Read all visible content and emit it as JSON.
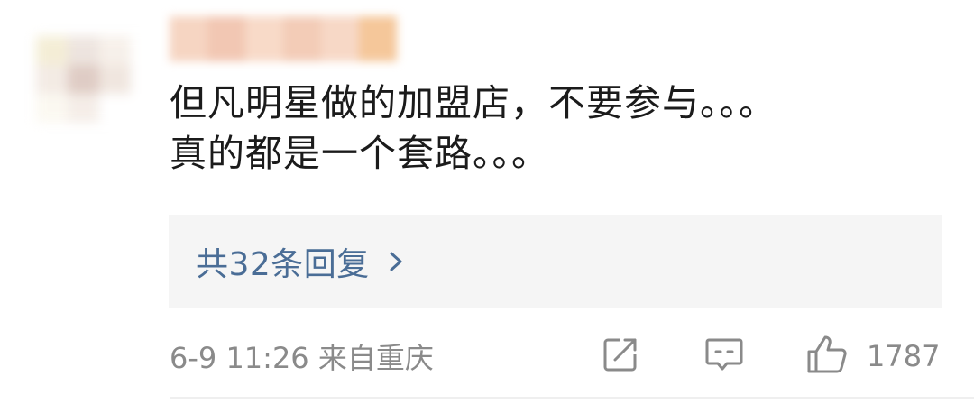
{
  "comment": {
    "lines": [
      "但凡明星做的加盟店，不要参与。。。",
      "真的都是一个套路。。。"
    ]
  },
  "replies": {
    "label": "共32条回复",
    "chevron_icon": "chevron-right-icon"
  },
  "meta": {
    "time_location": "6-9 11:26 来自重庆"
  },
  "actions": {
    "share_icon": "share-icon",
    "comment_icon": "comment-icon",
    "like_icon": "thumbs-up-icon",
    "like_count": "1787"
  },
  "colors": {
    "text": "#1b1b1b",
    "link": "#4a6d96",
    "meta": "#8a8a8a",
    "reply_bg": "#f5f5f5"
  }
}
